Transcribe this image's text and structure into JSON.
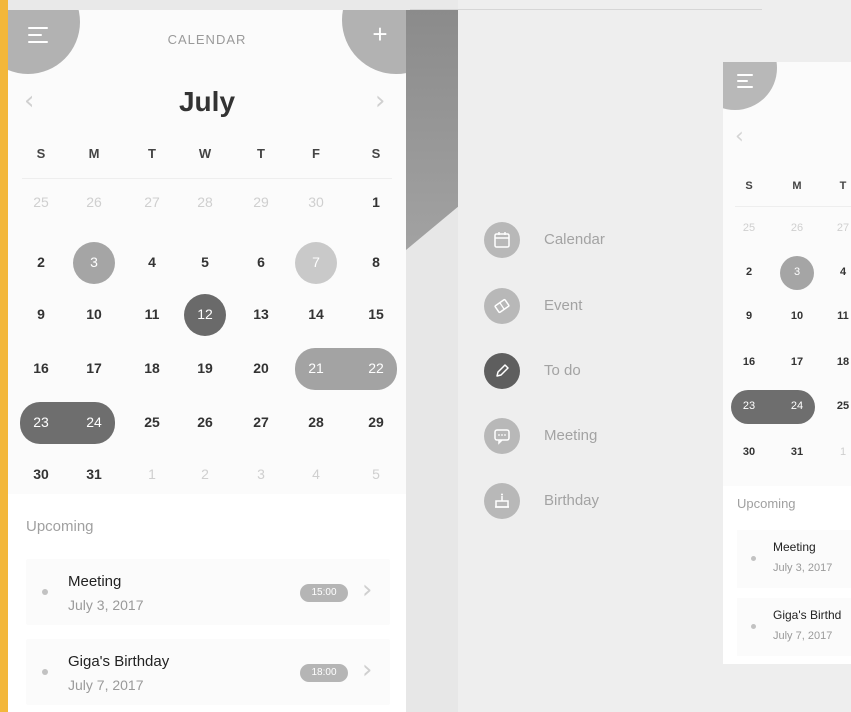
{
  "app": {
    "title": "CALENDAR",
    "month": "July",
    "weekdays": [
      "S",
      "M",
      "T",
      "W",
      "T",
      "F",
      "S"
    ]
  },
  "calendar": {
    "weeks": [
      [
        {
          "d": "25",
          "muted": true
        },
        {
          "d": "26",
          "muted": true
        },
        {
          "d": "27",
          "muted": true
        },
        {
          "d": "28",
          "muted": true
        },
        {
          "d": "29",
          "muted": true
        },
        {
          "d": "30",
          "muted": true
        },
        {
          "d": "1"
        }
      ],
      [
        {
          "d": "2"
        },
        {
          "d": "3",
          "mark": "circle-mid"
        },
        {
          "d": "4"
        },
        {
          "d": "5"
        },
        {
          "d": "6"
        },
        {
          "d": "7",
          "mark": "circle-light"
        },
        {
          "d": "8"
        }
      ],
      [
        {
          "d": "9"
        },
        {
          "d": "10"
        },
        {
          "d": "11"
        },
        {
          "d": "12",
          "mark": "circle-dark"
        },
        {
          "d": "13"
        },
        {
          "d": "14"
        },
        {
          "d": "15"
        }
      ],
      [
        {
          "d": "16"
        },
        {
          "d": "17"
        },
        {
          "d": "18"
        },
        {
          "d": "19"
        },
        {
          "d": "20"
        },
        {
          "d": "21",
          "mark": "pill-mid"
        },
        {
          "d": "22",
          "mark": "pill-mid"
        }
      ],
      [
        {
          "d": "23",
          "mark": "pill-dark"
        },
        {
          "d": "24",
          "mark": "pill-dark"
        },
        {
          "d": "25"
        },
        {
          "d": "26"
        },
        {
          "d": "27"
        },
        {
          "d": "28"
        },
        {
          "d": "29"
        }
      ],
      [
        {
          "d": "30"
        },
        {
          "d": "31"
        },
        {
          "d": "1",
          "muted": true
        },
        {
          "d": "2",
          "muted": true
        },
        {
          "d": "3",
          "muted": true
        },
        {
          "d": "4",
          "muted": true
        },
        {
          "d": "5",
          "muted": true
        }
      ]
    ]
  },
  "upcoming": {
    "label": "Upcoming",
    "events": [
      {
        "title": "Meeting",
        "date": "July 3, 2017",
        "time": "15:00"
      },
      {
        "title": "Giga's Birthday",
        "date": "July 7, 2017",
        "time": "18:00"
      }
    ]
  },
  "menu": {
    "items": [
      {
        "label": "Calendar",
        "icon": "calendar-icon"
      },
      {
        "label": "Event",
        "icon": "ticket-icon"
      },
      {
        "label": "To do",
        "icon": "pencil-icon",
        "active": true
      },
      {
        "label": "Meeting",
        "icon": "chat-icon"
      },
      {
        "label": "Birthday",
        "icon": "cake-icon"
      }
    ]
  },
  "right_preview": {
    "weekdays": [
      "S",
      "M",
      "T"
    ],
    "weeks": [
      [
        {
          "d": "25",
          "muted": true
        },
        {
          "d": "26",
          "muted": true
        },
        {
          "d": "27",
          "muted": true
        }
      ],
      [
        {
          "d": "2"
        },
        {
          "d": "3",
          "mark": "circle-mid"
        },
        {
          "d": "4"
        }
      ],
      [
        {
          "d": "9"
        },
        {
          "d": "10"
        },
        {
          "d": "11"
        }
      ],
      [
        {
          "d": "16"
        },
        {
          "d": "17"
        },
        {
          "d": "18"
        }
      ],
      [
        {
          "d": "23",
          "mark": "pill-dark"
        },
        {
          "d": "24",
          "mark": "pill-dark"
        },
        {
          "d": "25"
        }
      ],
      [
        {
          "d": "30"
        },
        {
          "d": "31"
        },
        {
          "d": "1",
          "muted": true
        }
      ]
    ],
    "upcoming_label": "Upcoming",
    "events": [
      {
        "title": "Meeting",
        "date": "July 3, 2017"
      },
      {
        "title": "Giga's Birthd",
        "date": "July 7, 2017"
      }
    ]
  },
  "colors": {
    "accent_dark": "#6a6a6a",
    "accent_mid": "#9d9d9d",
    "accent_light": "#c6c6c6",
    "side_strip": "#f3b73a"
  }
}
